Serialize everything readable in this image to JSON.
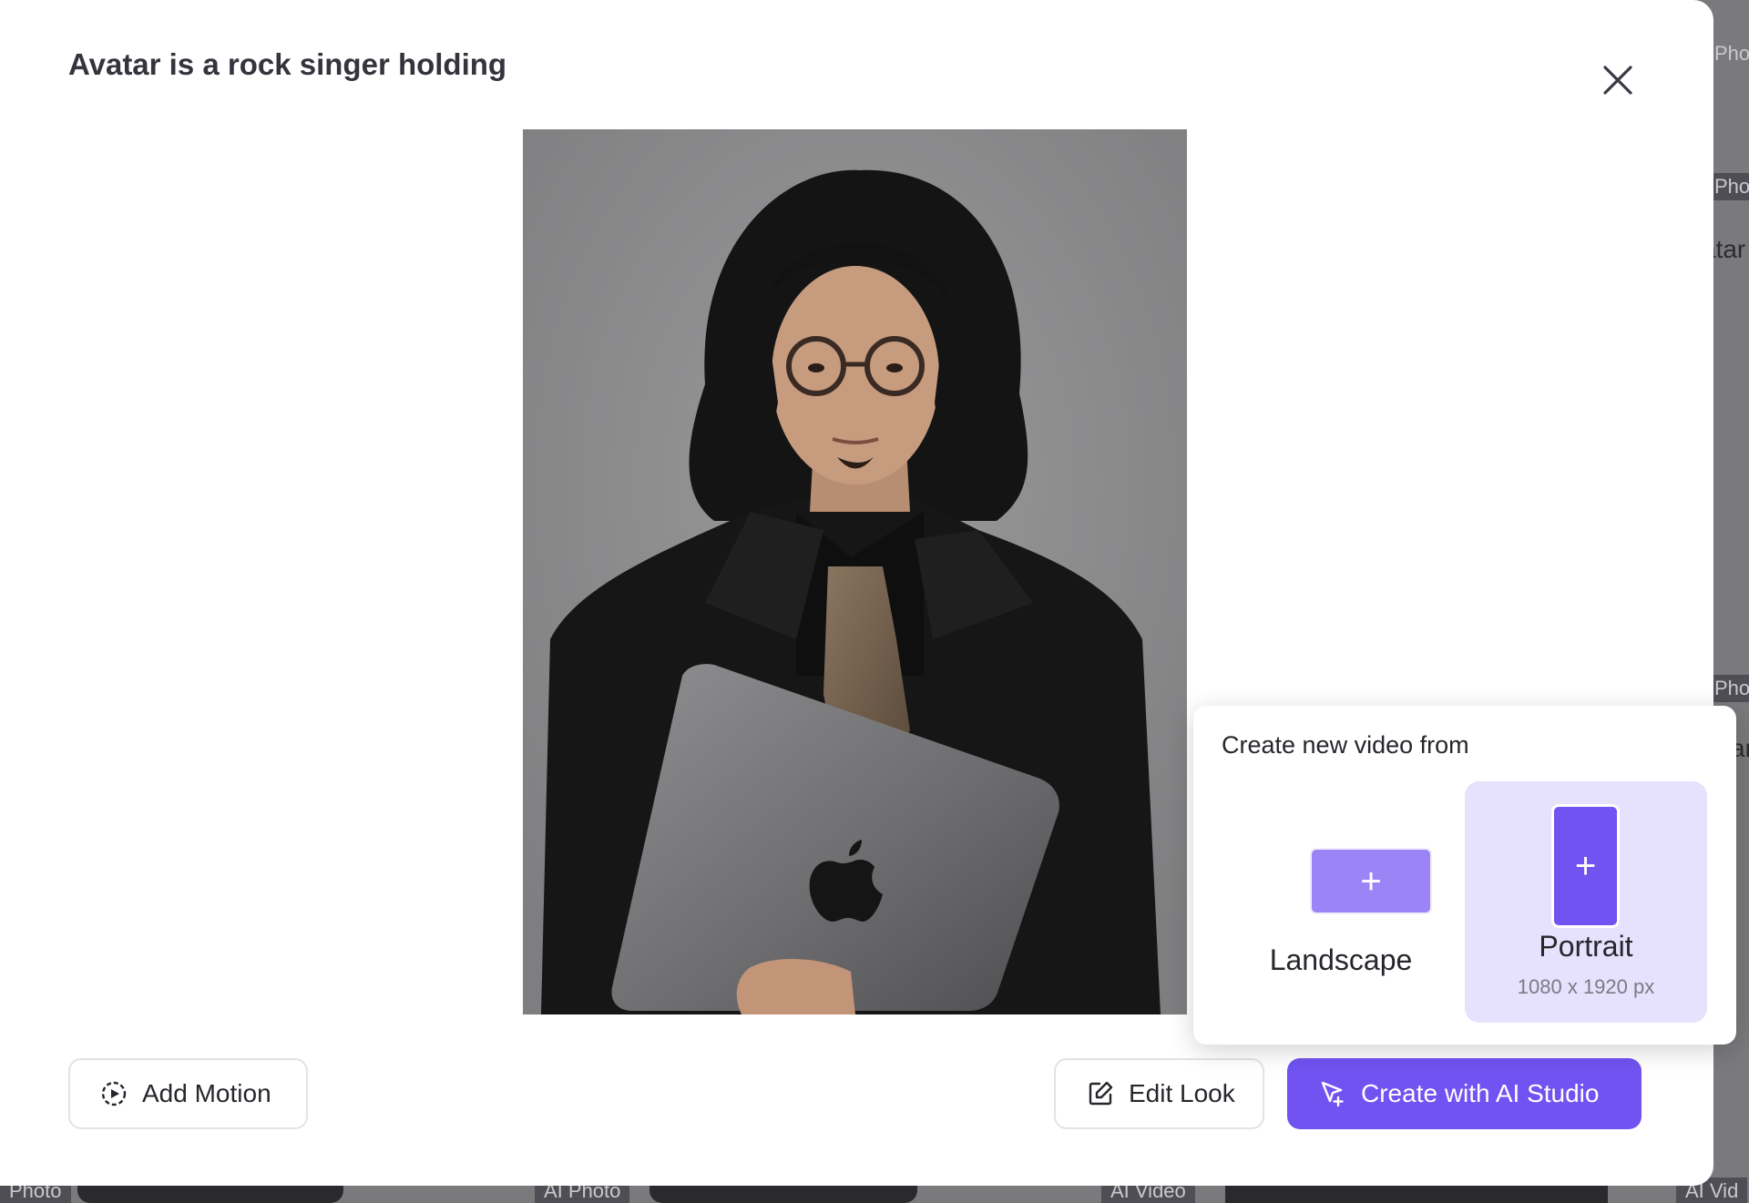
{
  "background": {
    "tags": [
      "Photo",
      "AI Photo",
      "AI Video",
      "AI Vid",
      "Pho",
      "Pho",
      "Pho"
    ],
    "partial_texts": [
      "atar",
      "ar"
    ]
  },
  "modal": {
    "title": "Avatar is a rock singer holding",
    "close_icon": "close-icon",
    "photo_alt": "Portrait photo of a long-haired man in glasses and a black suit holding a laptop"
  },
  "footer": {
    "add_motion_label": "Add Motion",
    "add_motion_icon": "motion-play-icon",
    "edit_look_label": "Edit Look",
    "edit_look_icon": "edit-icon",
    "create_label": "Create with AI Studio",
    "create_icon": "cursor-plus-icon"
  },
  "popover": {
    "title": "Create new video from",
    "options": [
      {
        "label": "Landscape",
        "sub": ""
      },
      {
        "label": "Portrait",
        "sub": "1080 x 1920 px"
      }
    ]
  },
  "colors": {
    "accent": "#7053f1",
    "accent_light": "#9a84f6",
    "selected_bg": "#e6e1fc",
    "text": "#26262c"
  }
}
